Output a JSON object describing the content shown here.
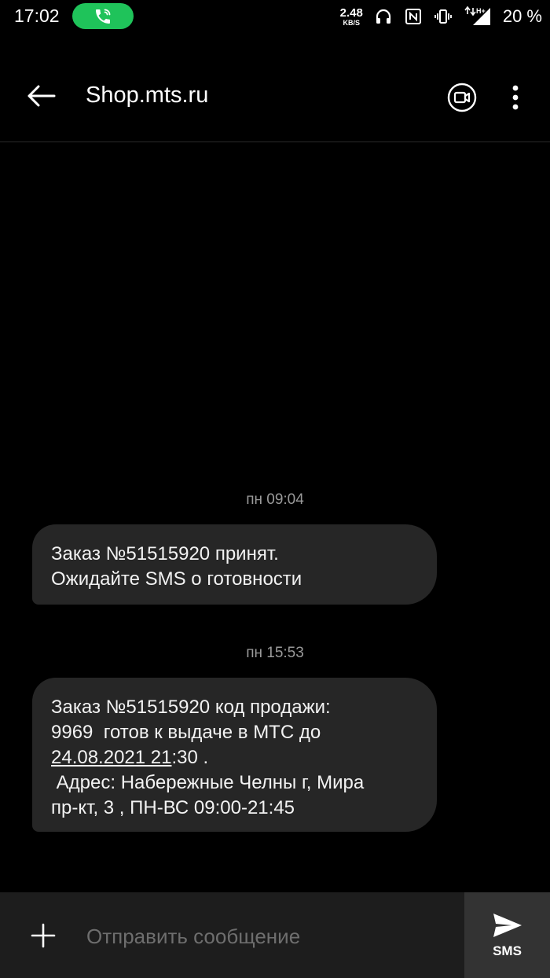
{
  "status_bar": {
    "time": "17:02",
    "net_speed_value": "2.48",
    "net_speed_unit": "KB/S",
    "network_type": "H+",
    "battery": "20 %"
  },
  "header": {
    "title": "Shop.mts.ru"
  },
  "messages": [
    {
      "timestamp": "пн 09:04",
      "lines": [
        "Заказ №51515920 принят.",
        "Ожидайте SMS о готовности"
      ]
    },
    {
      "timestamp": "пн 15:53",
      "line1": "Заказ №51515920 код продажи:",
      "line2": "9969  готов к выдаче в МТС до",
      "line3_link": "24.08.2021 21",
      "line3_rest": ":30 .",
      "line4": " Адрес: Набережные Челны г, Мира",
      "line5": "пр-кт, 3 , ПН-ВС 09:00-21:45"
    }
  ],
  "composer": {
    "placeholder": "Отправить сообщение",
    "send_label": "SMS"
  }
}
